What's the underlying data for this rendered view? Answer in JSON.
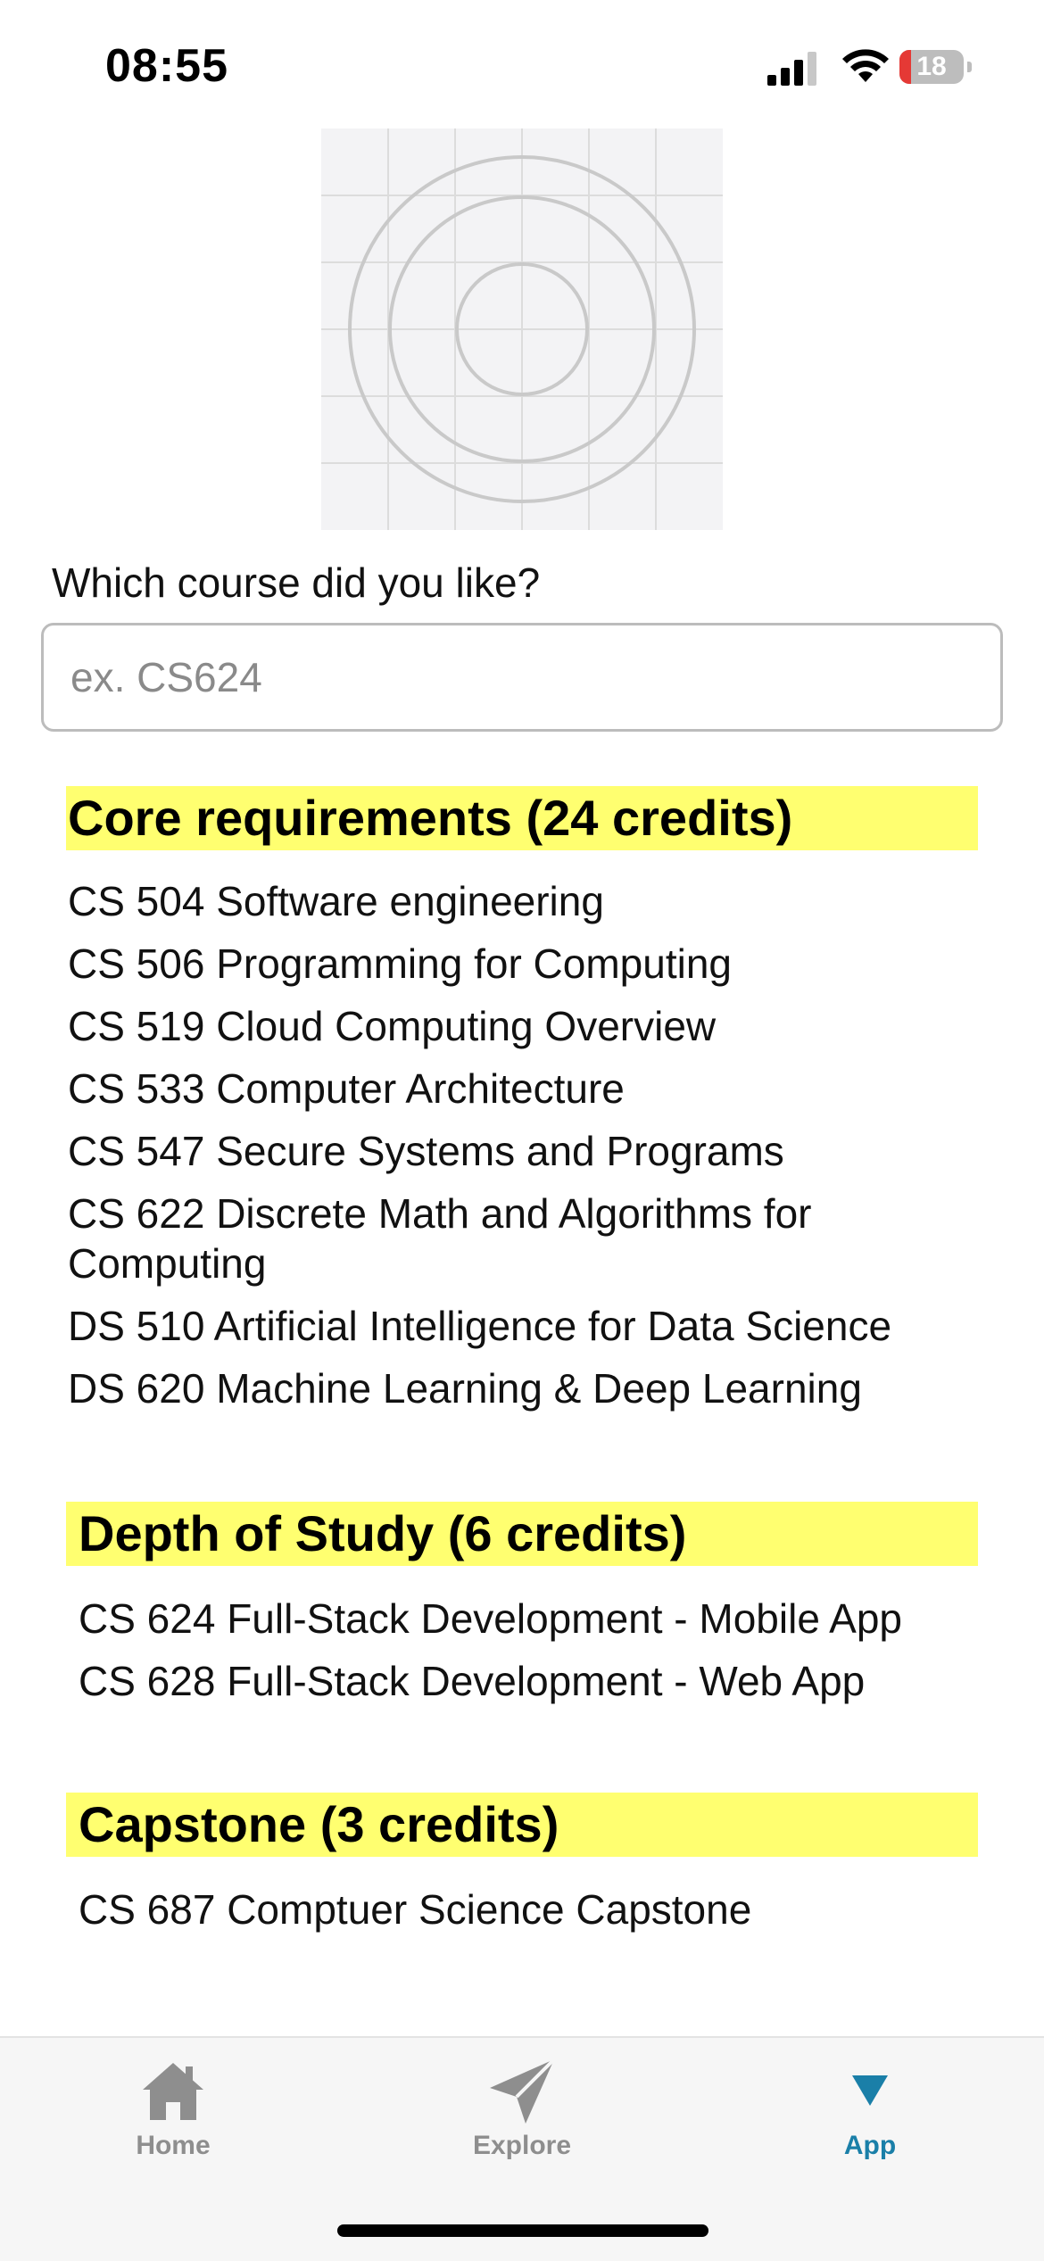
{
  "status_bar": {
    "time": "08:55",
    "battery_level": "18",
    "battery_fraction": 0.18,
    "signal_icon": "cellular-signal-icon",
    "wifi_icon": "wifi-icon"
  },
  "image": {
    "icon": "image-placeholder-icon"
  },
  "form": {
    "question": "Which course did you like?",
    "placeholder": "ex. CS624",
    "value": ""
  },
  "sections": [
    {
      "title": "Core requirements (24 credits)",
      "courses": [
        "CS 504 Software engineering",
        "CS 506 Programming for Computing",
        "CS 519 Cloud Computing Overview",
        "CS 533 Computer Architecture",
        "CS 547 Secure Systems and Programs",
        "CS 622 Discrete Math and Algorithms for Computing",
        "DS 510 Artificial Intelligence for Data Science",
        "DS 620 Machine Learning & Deep Learning"
      ]
    },
    {
      "title": "Depth of Study (6 credits)",
      "courses": [
        "CS 624 Full-Stack Development - Mobile App",
        "CS 628 Full-Stack Development - Web App"
      ]
    },
    {
      "title": "Capstone (3 credits)",
      "courses": [
        "CS 687 Comptuer Science Capstone"
      ]
    }
  ],
  "tab_bar": {
    "tabs": [
      {
        "label": "Home",
        "icon": "home-icon",
        "active": false
      },
      {
        "label": "Explore",
        "icon": "paper-plane-icon",
        "active": false
      },
      {
        "label": "App",
        "icon": "triangle-down-icon",
        "active": true
      }
    ]
  },
  "colors": {
    "highlight": "#ffff70",
    "active_tab": "#1a7fa8",
    "inactive_tab": "#8e8e8e",
    "battery_low": "#e53935"
  }
}
